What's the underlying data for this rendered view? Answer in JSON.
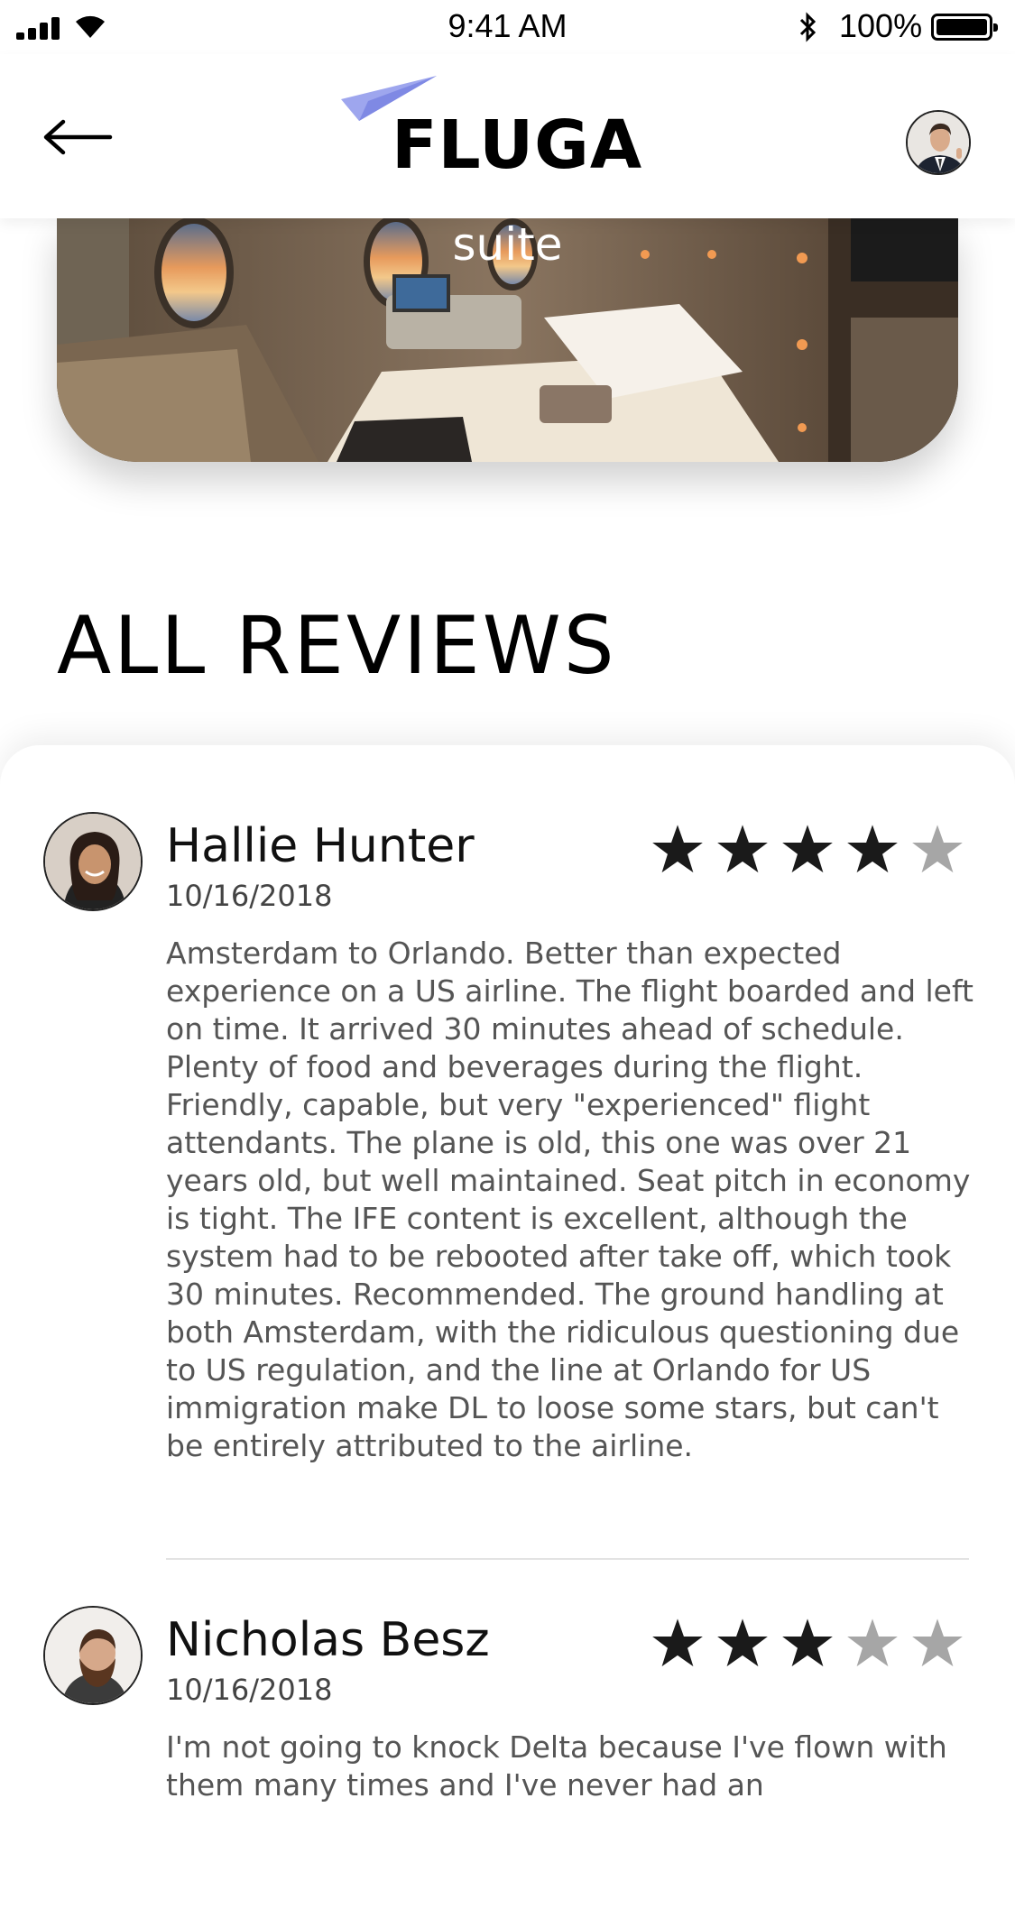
{
  "status_bar": {
    "time": "9:41 AM",
    "battery_percent": "100%",
    "icons": [
      "signal-icon",
      "wifi-icon",
      "bluetooth-icon",
      "battery-icon"
    ]
  },
  "header": {
    "logo_text": "FLUGA",
    "back_icon": "arrow-left-icon",
    "profile": "avatar"
  },
  "hero": {
    "title": "suite"
  },
  "section": {
    "title": "ALL REVIEWS"
  },
  "reviews": [
    {
      "name": "Hallie Hunter",
      "date": "10/16/2018",
      "rating": 4,
      "max_rating": 5,
      "text": "Amsterdam to Orlando. Better than expected experience on a US airline. The flight boarded and left on time. It arrived 30 minutes ahead of schedule. Plenty of food and beverages during the flight. Friendly, capable, but very \"experienced\" flight attendants. The plane is old, this one was over 21 years old, but well maintained. Seat pitch in economy is tight. The IFE content is excellent, although the system had to be rebooted after take off, which took 30 minutes. Recommended. The ground handling at both Amsterdam, with the ridiculous questioning due to US regulation, and the line at Orlando for US immigration make DL to loose some stars, but can't be entirely attributed to the airline."
    },
    {
      "name": "Nicholas Besz",
      "date": "10/16/2018",
      "rating": 3,
      "max_rating": 5,
      "text": "I'm not going to knock Delta because I've flown with them many times and I've never had an"
    }
  ],
  "colors": {
    "star_filled": "#1a1a1a",
    "star_empty": "#a6a6a6",
    "logo_plane": "#9ea6ee"
  }
}
